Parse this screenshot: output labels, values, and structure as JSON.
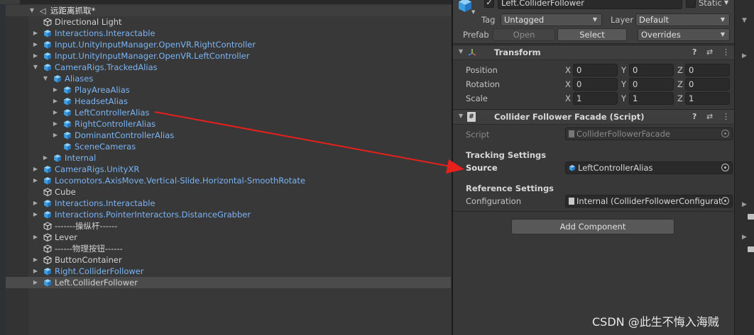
{
  "hierarchy": {
    "scene": "远距离抓取*",
    "items": [
      {
        "label": "Directional Light",
        "prefab": false,
        "arrow": ""
      },
      {
        "label": "Interactions.Interactable",
        "prefab": true,
        "arrow": "collapsed"
      },
      {
        "label": "Input.UnityInputManager.OpenVR.RightController",
        "prefab": true,
        "arrow": "collapsed"
      },
      {
        "label": "Input.UnityInputManager.OpenVR.LeftController",
        "prefab": true,
        "arrow": "collapsed"
      },
      {
        "label": "CameraRigs.TrackedAlias",
        "prefab": true,
        "arrow": "expanded"
      },
      {
        "label": "Aliases",
        "prefab": true,
        "arrow": "expanded"
      },
      {
        "label": "PlayAreaAlias",
        "prefab": true,
        "arrow": "collapsed"
      },
      {
        "label": "HeadsetAlias",
        "prefab": true,
        "arrow": "collapsed"
      },
      {
        "label": "LeftControllerAlias",
        "prefab": true,
        "arrow": "collapsed"
      },
      {
        "label": "RightControllerAlias",
        "prefab": true,
        "arrow": "collapsed"
      },
      {
        "label": "DominantControllerAlias",
        "prefab": true,
        "arrow": "collapsed"
      },
      {
        "label": "SceneCameras",
        "prefab": true,
        "arrow": ""
      },
      {
        "label": "Internal",
        "prefab": true,
        "arrow": "collapsed"
      },
      {
        "label": "CameraRigs.UnityXR",
        "prefab": true,
        "arrow": "collapsed"
      },
      {
        "label": "Locomotors.AxisMove.Vertical-Slide.Horizontal-SmoothRotate",
        "prefab": true,
        "arrow": "collapsed"
      },
      {
        "label": "Cube",
        "prefab": false,
        "arrow": ""
      },
      {
        "label": "Interactions.Interactable",
        "prefab": true,
        "arrow": "collapsed"
      },
      {
        "label": "Interactions.PointerInteractors.DistanceGrabber",
        "prefab": true,
        "arrow": "collapsed"
      },
      {
        "label": "-------操纵杆------",
        "prefab": false,
        "arrow": ""
      },
      {
        "label": "Lever",
        "prefab": false,
        "arrow": "collapsed"
      },
      {
        "label": "------物理按钮------",
        "prefab": false,
        "arrow": ""
      },
      {
        "label": "ButtonContainer",
        "prefab": false,
        "arrow": "collapsed"
      },
      {
        "label": "Right.ColliderFollower",
        "prefab": true,
        "arrow": "collapsed"
      },
      {
        "label": "Left.ColliderFollower",
        "prefab": false,
        "arrow": "collapsed",
        "selected": true
      }
    ]
  },
  "inspector": {
    "object_name": "Left.ColliderFollower",
    "static_label": "Static",
    "tag_label": "Tag",
    "tag_value": "Untagged",
    "layer_label": "Layer",
    "layer_value": "Default",
    "prefab_label": "Prefab",
    "open_label": "Open",
    "select_label": "Select",
    "overrides_label": "Overrides",
    "transform": {
      "title": "Transform",
      "rows": [
        {
          "label": "Position",
          "x": "0",
          "y": "0",
          "z": "0"
        },
        {
          "label": "Rotation",
          "x": "0",
          "y": "0",
          "z": "0"
        },
        {
          "label": "Scale",
          "x": "1",
          "y": "1",
          "z": "1"
        }
      ],
      "axis_x": "X",
      "axis_y": "Y",
      "axis_z": "Z"
    },
    "component": {
      "title": "Collider Follower Facade (Script)",
      "script_label": "Script",
      "script_value": "ColliderFollowerFacade",
      "tracking_header": "Tracking Settings",
      "source_label": "Source",
      "source_value": "LeftControllerAlias",
      "reference_header": "Reference Settings",
      "configuration_label": "Configuration",
      "configuration_value": "Internal (ColliderFollowerConfigurat"
    },
    "add_component_label": "Add Component"
  },
  "watermark": "CSDN @此生不悔入海贼",
  "colors": {
    "prefab_blue": "#7cb4f2",
    "arrow_red": "#e8201c"
  }
}
